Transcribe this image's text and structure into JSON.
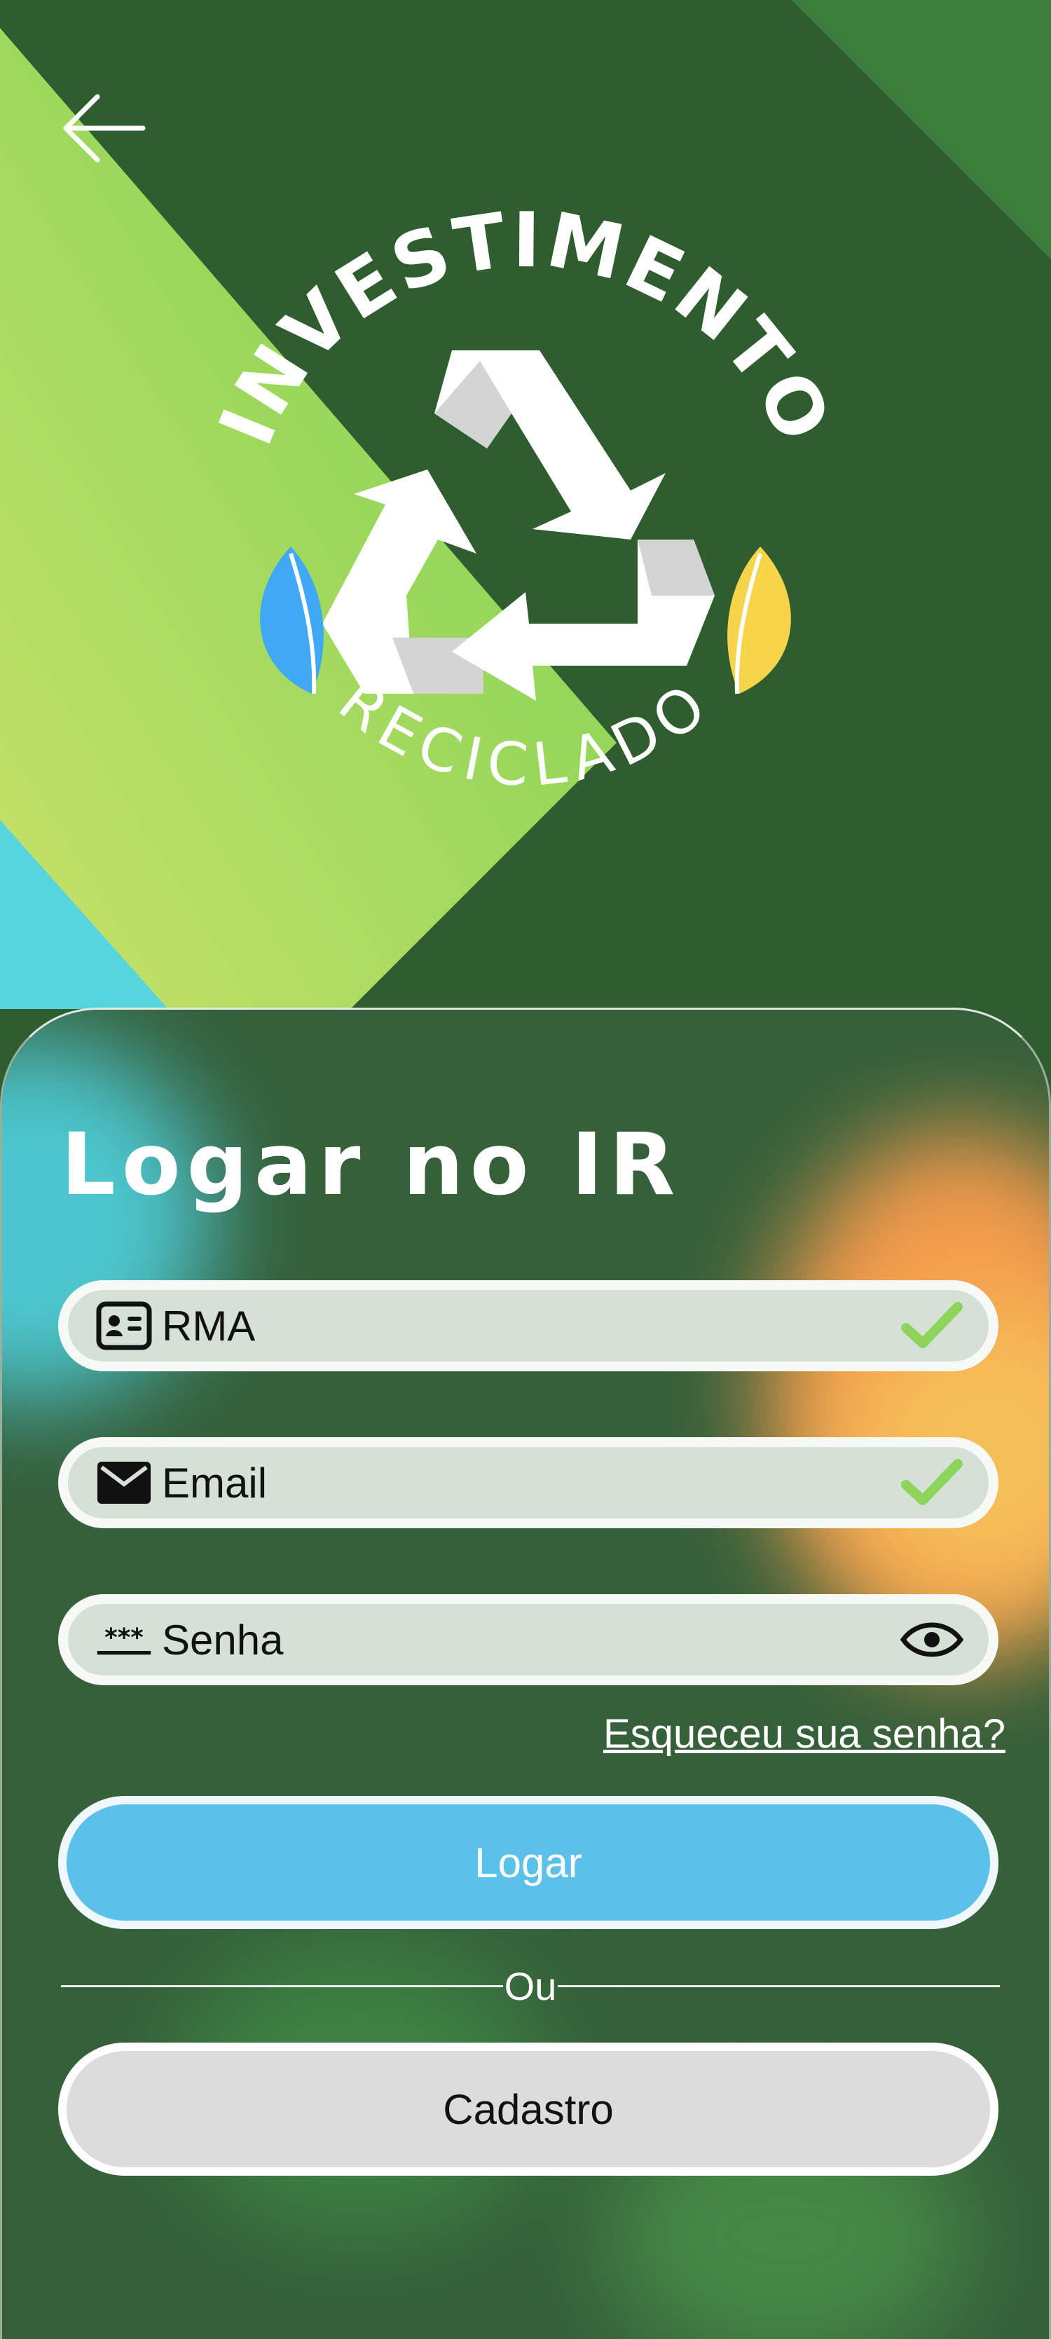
{
  "logo": {
    "arc_text": "INVESTIMENTO",
    "bottom_text": "RECICLADO"
  },
  "login": {
    "title": "Logar no IR",
    "fields": [
      {
        "label": "RMA",
        "icon": "id-card-icon",
        "status": "valid"
      },
      {
        "label": "Email",
        "icon": "mail-icon",
        "status": "valid"
      },
      {
        "label": "Senha",
        "icon": "password-icon",
        "status": "visibility-toggle"
      }
    ],
    "forgot_password": "Esqueceu sua senha?",
    "login_button": "Logar",
    "divider_text": "Ou",
    "signup_button": "Cadastro"
  },
  "colors": {
    "dark_green": "#2f5d2f",
    "light_green": "#8ed45a",
    "accent_blue": "#5bc0ea",
    "check_green": "#8ed45a",
    "leaf_blue": "#3fa9f5",
    "leaf_yellow": "#f7d54a"
  }
}
